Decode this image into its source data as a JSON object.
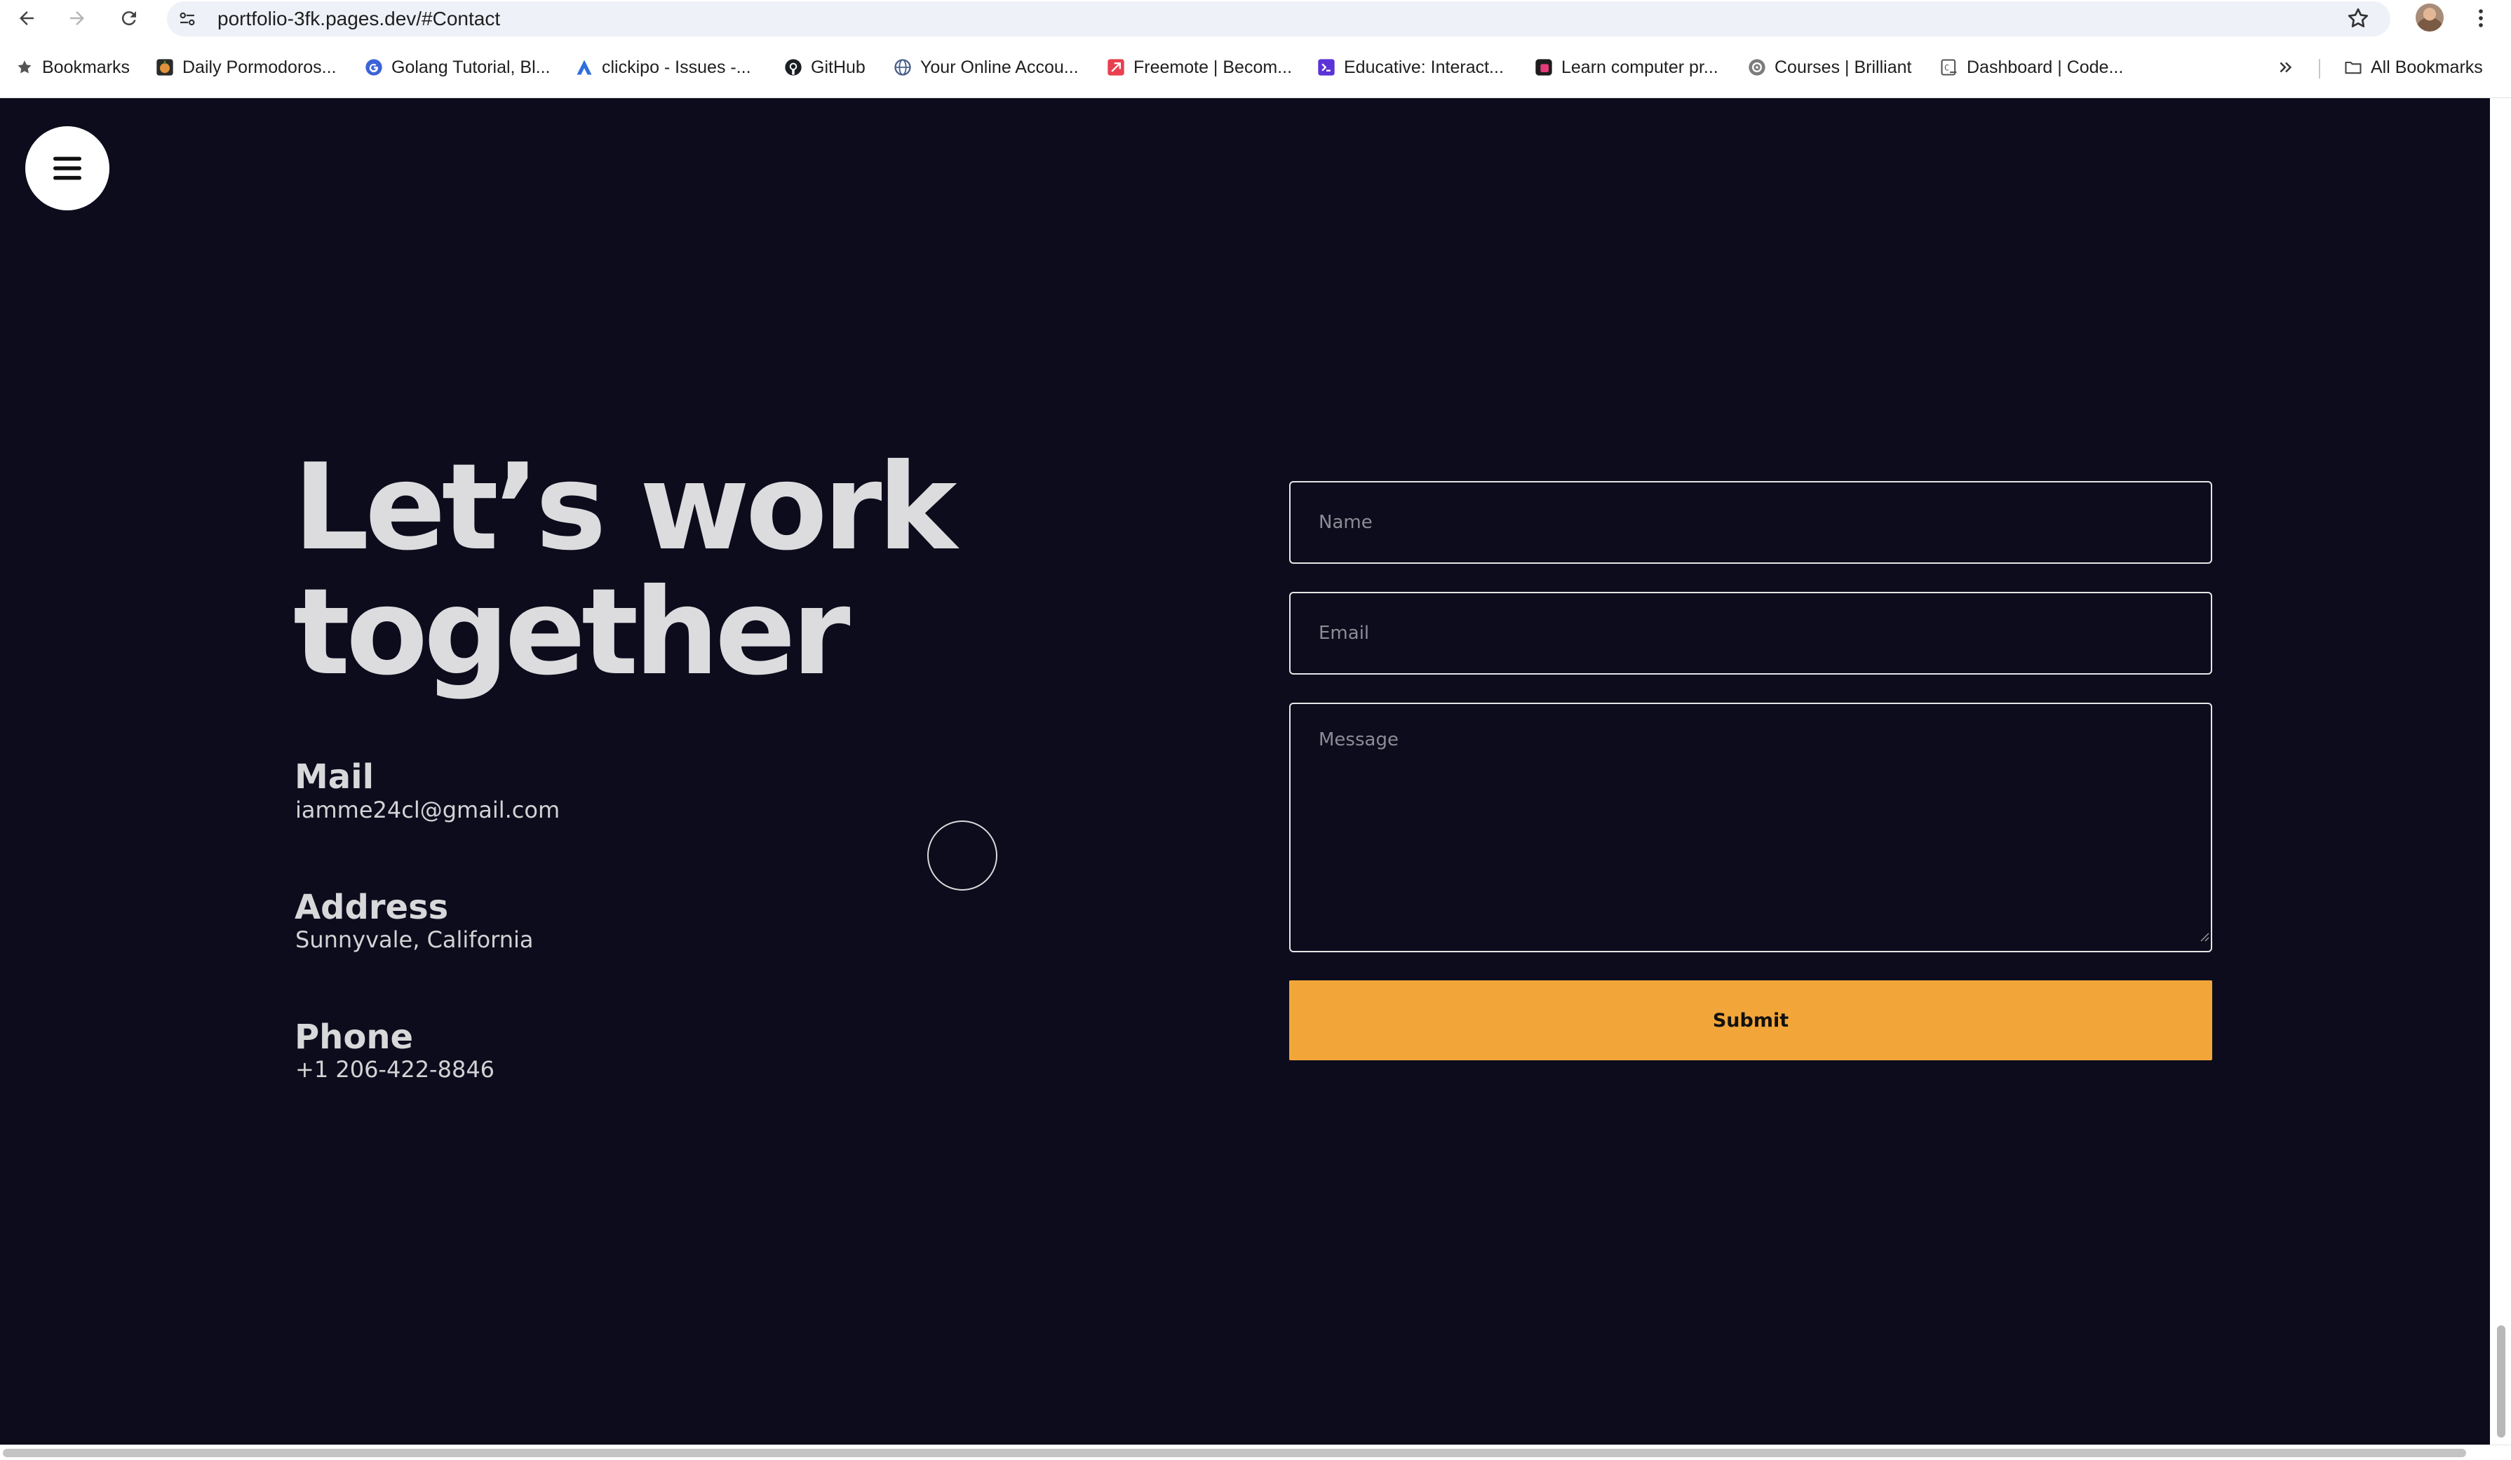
{
  "browser": {
    "url": "portfolio-3fk.pages.dev/#Contact",
    "icons": {
      "back": "back-arrow-icon",
      "forward": "forward-arrow-icon",
      "reload": "reload-icon",
      "site_info": "site-settings-icon",
      "bookmark_star": "star-icon",
      "menu": "vertical-dots-icon"
    }
  },
  "bookmarks": {
    "items": [
      {
        "label": "Bookmarks",
        "icon": "star-icon"
      },
      {
        "label": "Daily Pormodoros...",
        "icon": "tomato-favicon"
      },
      {
        "label": "Golang Tutorial, Bl...",
        "icon": "google-favicon"
      },
      {
        "label": "clickipo - Issues -...",
        "icon": "jira-favicon"
      },
      {
        "label": "GitHub",
        "icon": "github-favicon"
      },
      {
        "label": "Your Online Accou...",
        "icon": "globe-favicon"
      },
      {
        "label": "Freemote | Becom...",
        "icon": "freemote-favicon"
      },
      {
        "label": "Educative: Interact...",
        "icon": "educative-favicon"
      },
      {
        "label": "Learn computer pr...",
        "icon": "learn-favicon"
      },
      {
        "label": "Courses | Brilliant",
        "icon": "brilliant-favicon"
      },
      {
        "label": "Dashboard | Code...",
        "icon": "code-favicon"
      }
    ],
    "overflow_icon": "double-chevron-icon",
    "all_bookmarks": {
      "label": "All Bookmarks",
      "icon": "folder-icon"
    }
  },
  "page": {
    "menu_icon": "hamburger-icon",
    "headline": {
      "line1": "Let’s work",
      "line2": "together"
    },
    "contact": [
      {
        "label": "Mail",
        "value": "iamme24cl@gmail.com"
      },
      {
        "label": "Address",
        "value": "Sunnyvale, California"
      },
      {
        "label": "Phone",
        "value": "+1 206-422-8846"
      }
    ],
    "form": {
      "name_placeholder": "Name",
      "email_placeholder": "Email",
      "message_placeholder": "Message",
      "name_value": "",
      "email_value": "",
      "message_value": "",
      "submit_label": "Submit"
    }
  },
  "colors": {
    "page_background": "#0c0c1d",
    "accent": "#f2a63a",
    "headline_text": "#dcdcde",
    "field_border": "#e6e6e6"
  }
}
